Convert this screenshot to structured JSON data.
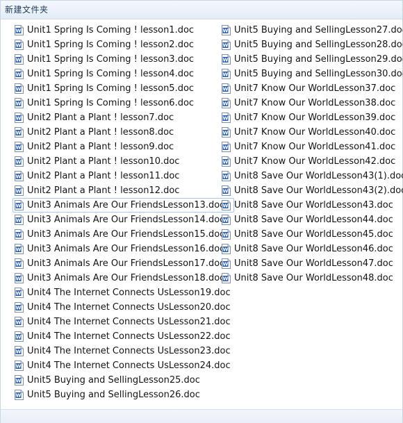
{
  "window": {
    "title": "新建文件夹"
  },
  "files": {
    "left": [
      {
        "name": "Unit1 Spring Is Coming ! lesson1.doc"
      },
      {
        "name": "Unit1 Spring Is Coming ! lesson2.doc"
      },
      {
        "name": "Unit1 Spring Is Coming ! lesson3.doc"
      },
      {
        "name": "Unit1 Spring Is Coming ! lesson4.doc"
      },
      {
        "name": "Unit1 Spring Is Coming ! lesson5.doc"
      },
      {
        "name": "Unit1 Spring Is Coming ! lesson6.doc"
      },
      {
        "name": "Unit2 Plant a Plant ! lesson7.doc"
      },
      {
        "name": "Unit2 Plant a Plant ! lesson8.doc"
      },
      {
        "name": "Unit2 Plant a Plant ! lesson9.doc"
      },
      {
        "name": "Unit2 Plant a Plant ! lesson10.doc"
      },
      {
        "name": "Unit2 Plant a Plant ! lesson11.doc"
      },
      {
        "name": "Unit2 Plant a Plant ! lesson12.doc"
      },
      {
        "name": "Unit3 Animals Are Our FriendsLesson13.doc",
        "focused": true
      },
      {
        "name": "Unit3 Animals Are Our FriendsLesson14.doc"
      },
      {
        "name": "Unit3 Animals Are Our FriendsLesson15.doc"
      },
      {
        "name": "Unit3 Animals Are Our FriendsLesson16.doc"
      },
      {
        "name": "Unit3 Animals Are Our FriendsLesson17.doc"
      },
      {
        "name": "Unit3 Animals Are Our FriendsLesson18.doc"
      },
      {
        "name": "Unit4 The Internet Connects UsLesson19.doc"
      },
      {
        "name": "Unit4 The Internet Connects UsLesson20.doc"
      },
      {
        "name": "Unit4 The Internet Connects UsLesson21.doc"
      },
      {
        "name": "Unit4 The Internet Connects UsLesson22.doc"
      },
      {
        "name": "Unit4 The Internet Connects UsLesson23.doc"
      },
      {
        "name": "Unit4 The Internet Connects UsLesson24.doc"
      },
      {
        "name": "Unit5 Buying and SellingLesson25.doc"
      },
      {
        "name": "Unit5 Buying and SellingLesson26.doc"
      }
    ],
    "right": [
      {
        "name": "Unit5 Buying and SellingLesson27.doc"
      },
      {
        "name": "Unit5 Buying and SellingLesson28.doc"
      },
      {
        "name": "Unit5 Buying and SellingLesson29.doc"
      },
      {
        "name": "Unit5 Buying and SellingLesson30.doc"
      },
      {
        "name": "Unit7 Know Our WorldLesson37.doc"
      },
      {
        "name": "Unit7 Know Our WorldLesson38.doc"
      },
      {
        "name": "Unit7 Know Our WorldLesson39.doc"
      },
      {
        "name": "Unit7 Know Our WorldLesson40.doc"
      },
      {
        "name": "Unit7 Know Our WorldLesson41.doc"
      },
      {
        "name": "Unit7 Know Our WorldLesson42.doc"
      },
      {
        "name": "Unit8 Save Our WorldLesson43(1).doc"
      },
      {
        "name": "Unit8 Save Our WorldLesson43(2).doc"
      },
      {
        "name": "Unit8 Save Our WorldLesson43.doc"
      },
      {
        "name": "Unit8 Save Our WorldLesson44.doc"
      },
      {
        "name": "Unit8 Save Our WorldLesson45.doc"
      },
      {
        "name": "Unit8 Save Our WorldLesson46.doc"
      },
      {
        "name": "Unit8 Save Our WorldLesson47.doc"
      },
      {
        "name": "Unit8 Save Our WorldLesson48.doc"
      }
    ],
    "icon": "word-document-icon"
  },
  "colors": {
    "icon_blue": "#2b5ea8",
    "focus_border": "#a9c9ec",
    "title_text": "#1e395b"
  }
}
